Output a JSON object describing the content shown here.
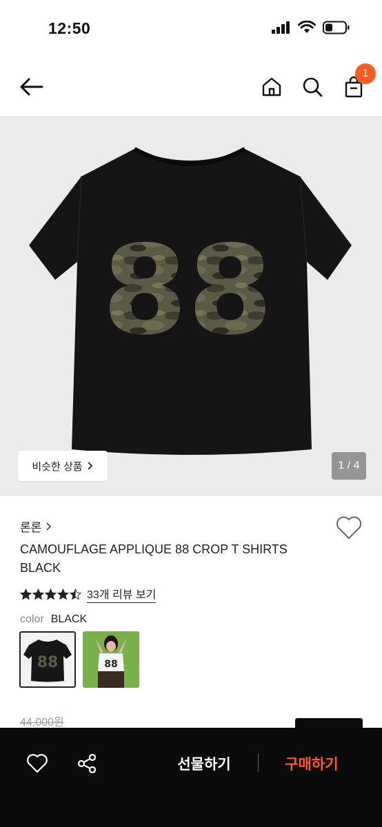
{
  "status_bar": {
    "time": "12:50"
  },
  "header": {
    "cart_count": "1"
  },
  "gallery": {
    "similar_label": "비슷한 상품",
    "page_indicator": "1 / 4",
    "print_number": "88"
  },
  "product": {
    "brand": "론론",
    "title": "CAMOUFLAGE APPLIQUE 88 CROP T SHIRTS BLACK",
    "rating": 4.5,
    "review_link": "33개 리뷰 보기",
    "color_label": "color",
    "color_value": "BLACK",
    "thumb_print": "88",
    "original_price": "44,000원"
  },
  "bottom_bar": {
    "gift_label": "선물하기",
    "buy_label": "구매하기"
  },
  "colors": {
    "accent": "#ff5a1f",
    "bottom_bar_bg": "#0b0b0b",
    "gallery_bg": "#ebebeb"
  },
  "icons": [
    "back-arrow-icon",
    "home-icon",
    "search-icon",
    "shopping-bag-icon",
    "heart-icon",
    "share-icon",
    "chevron-right-icon",
    "star-icon"
  ]
}
